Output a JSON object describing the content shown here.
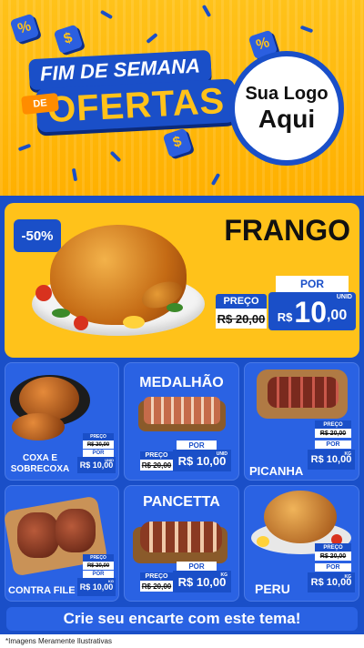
{
  "header": {
    "title_top": "FIM DE SEMANA",
    "title_badge": "DE",
    "title_main": "OFERTAS",
    "cube_glyphs": [
      "%",
      "$",
      "%",
      "$"
    ],
    "logo_line1": "Sua Logo",
    "logo_line2": "Aqui"
  },
  "featured": {
    "discount": "-50%",
    "name": "FRANGO",
    "old_label": "PREÇO",
    "old_price": "R$ 20,00",
    "por_label": "POR",
    "currency": "R$",
    "price_int": "10",
    "price_dec": ",00",
    "unit": "UNID"
  },
  "products": [
    {
      "name": "COXA E SOBRECOXA",
      "old_label": "PREÇO",
      "old_price": "R$ 20,00",
      "por_label": "POR",
      "price": "R$ 10,00",
      "unit": "UNID"
    },
    {
      "name": "MEDALHÃO",
      "old_label": "PREÇO",
      "old_price": "R$ 20,00",
      "por_label": "POR",
      "price": "R$ 10,00",
      "unit": "UNID"
    },
    {
      "name": "PICANHA",
      "old_label": "PREÇO",
      "old_price": "R$ 20,00",
      "por_label": "POR",
      "price": "R$ 10,00",
      "unit": "KG"
    },
    {
      "name": "CONTRA FILE",
      "old_label": "PREÇO",
      "old_price": "R$ 20,00",
      "por_label": "POR",
      "price": "R$ 10,00",
      "unit": "KG"
    },
    {
      "name": "PANCETTA",
      "old_label": "PREÇO",
      "old_price": "R$ 20,00",
      "por_label": "POR",
      "price": "R$ 10,00",
      "unit": "KG"
    },
    {
      "name": "PERU",
      "old_label": "PREÇO",
      "old_price": "R$ 20,00",
      "por_label": "POR",
      "price": "R$ 10,00",
      "unit": "KG"
    }
  ],
  "cta": "Crie seu encarte com este tema!",
  "footnote": "*Imagens Meramente Ilustrativas",
  "colors": {
    "brand_blue": "#1a4fc8",
    "card_blue": "#2a62e3",
    "yellow": "#ffc21a"
  }
}
